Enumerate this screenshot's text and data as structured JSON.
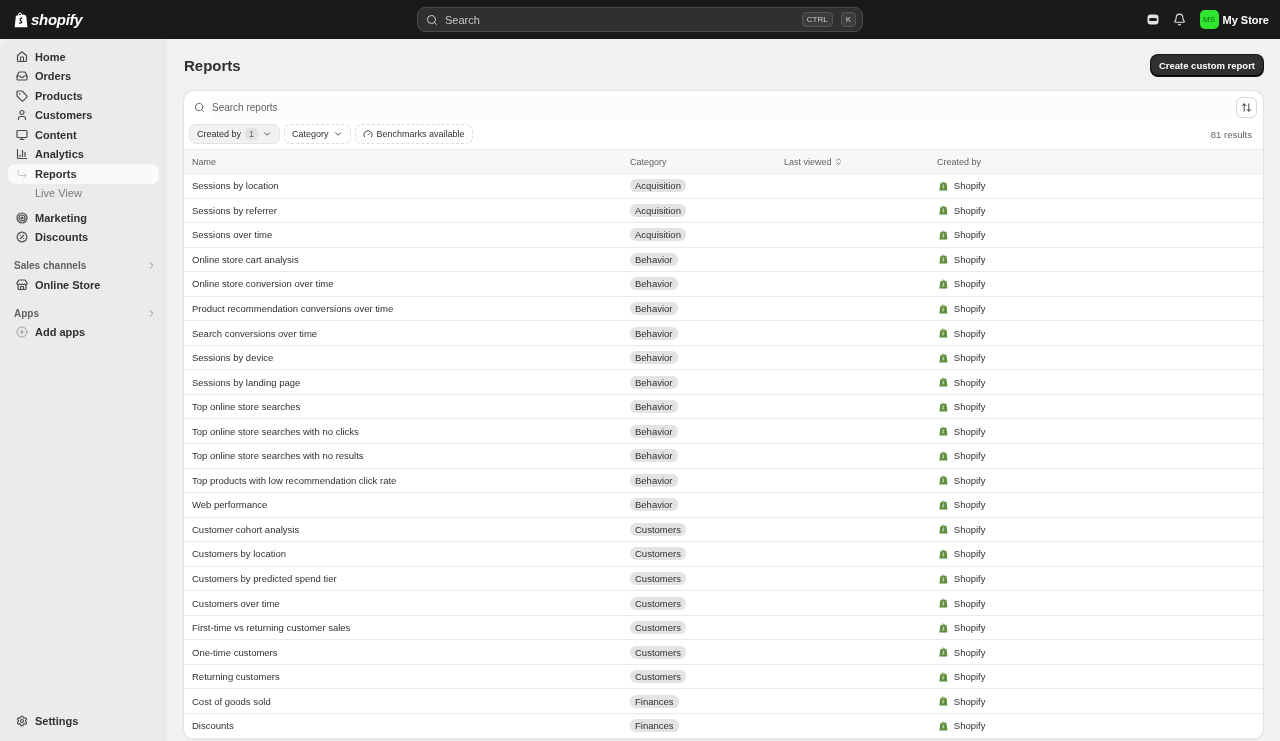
{
  "topbar": {
    "logo": "shopify",
    "search": {
      "placeholder": "Search",
      "shortcut": [
        "CTRL",
        "K"
      ]
    },
    "avatar": "MS",
    "store": "My Store"
  },
  "sidebar": {
    "items": [
      {
        "label": "Home",
        "selected": false
      },
      {
        "label": "Orders",
        "selected": false
      },
      {
        "label": "Products",
        "selected": false
      },
      {
        "label": "Customers",
        "selected": false
      },
      {
        "label": "Content",
        "selected": false
      },
      {
        "label": "Analytics",
        "selected": false,
        "children": [
          {
            "label": "Reports",
            "selected": true
          },
          {
            "label": "Live View",
            "selected": false
          }
        ]
      },
      {
        "label": "Marketing",
        "selected": false
      },
      {
        "label": "Discounts",
        "selected": false
      }
    ],
    "sections": [
      {
        "title": "Sales channels",
        "items": [
          {
            "label": "Online Store",
            "selected": false
          }
        ]
      },
      {
        "title": "Apps",
        "items": [
          {
            "label": "Add apps",
            "selected": false
          }
        ]
      }
    ],
    "footer": {
      "label": "Settings"
    }
  },
  "page": {
    "title": "Reports",
    "primary_button": "Create custom report"
  },
  "search": {
    "placeholder": "Search reports"
  },
  "filters": [
    {
      "kind": "dropdown",
      "label": "Created by",
      "count": "1",
      "active": true
    },
    {
      "kind": "dropdown",
      "label": "Category",
      "active": false
    },
    {
      "kind": "toggle",
      "label": "Benchmarks available",
      "active": false
    }
  ],
  "results": "81 results",
  "table": {
    "columns": [
      {
        "label": "Name",
        "sortable": false
      },
      {
        "label": "Category",
        "sortable": false
      },
      {
        "label": "Last viewed",
        "sortable": true
      },
      {
        "label": "Created by",
        "sortable": false
      }
    ],
    "rows": [
      {
        "name": "Sessions by location",
        "category": "Acquisition",
        "created_by": "Shopify"
      },
      {
        "name": "Sessions by referrer",
        "category": "Acquisition",
        "created_by": "Shopify"
      },
      {
        "name": "Sessions over time",
        "category": "Acquisition",
        "created_by": "Shopify"
      },
      {
        "name": "Online store cart analysis",
        "category": "Behavior",
        "created_by": "Shopify"
      },
      {
        "name": "Online store conversion over time",
        "category": "Behavior",
        "created_by": "Shopify"
      },
      {
        "name": "Product recommendation conversions over time",
        "category": "Behavior",
        "created_by": "Shopify"
      },
      {
        "name": "Search conversions over time",
        "category": "Behavior",
        "created_by": "Shopify"
      },
      {
        "name": "Sessions by device",
        "category": "Behavior",
        "created_by": "Shopify"
      },
      {
        "name": "Sessions by landing page",
        "category": "Behavior",
        "created_by": "Shopify"
      },
      {
        "name": "Top online store searches",
        "category": "Behavior",
        "created_by": "Shopify"
      },
      {
        "name": "Top online store searches with no clicks",
        "category": "Behavior",
        "created_by": "Shopify"
      },
      {
        "name": "Top online store searches with no results",
        "category": "Behavior",
        "created_by": "Shopify"
      },
      {
        "name": "Top products with low recommendation click rate",
        "category": "Behavior",
        "created_by": "Shopify"
      },
      {
        "name": "Web performance",
        "category": "Behavior",
        "created_by": "Shopify"
      },
      {
        "name": "Customer cohort analysis",
        "category": "Customers",
        "created_by": "Shopify"
      },
      {
        "name": "Customers by location",
        "category": "Customers",
        "created_by": "Shopify"
      },
      {
        "name": "Customers by predicted spend tier",
        "category": "Customers",
        "created_by": "Shopify"
      },
      {
        "name": "Customers over time",
        "category": "Customers",
        "created_by": "Shopify"
      },
      {
        "name": "First-time vs returning customer sales",
        "category": "Customers",
        "created_by": "Shopify"
      },
      {
        "name": "One-time customers",
        "category": "Customers",
        "created_by": "Shopify"
      },
      {
        "name": "Returning customers",
        "category": "Customers",
        "created_by": "Shopify"
      },
      {
        "name": "Cost of goods sold",
        "category": "Finances",
        "created_by": "Shopify"
      },
      {
        "name": "Discounts",
        "category": "Finances",
        "created_by": "Shopify"
      }
    ]
  }
}
